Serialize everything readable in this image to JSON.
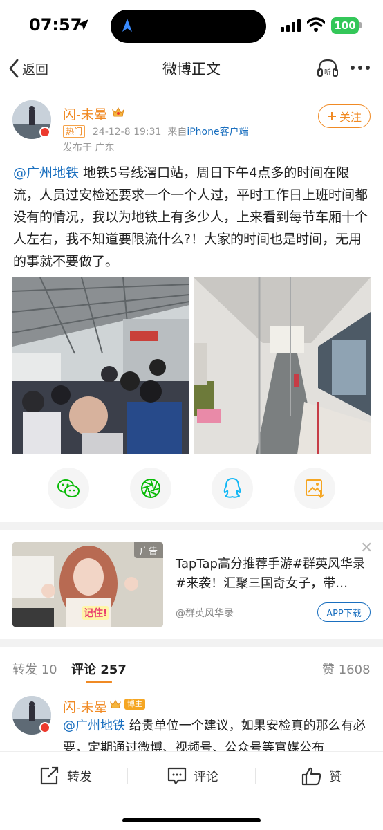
{
  "status_bar": {
    "time": "07:57",
    "battery": "100"
  },
  "nav": {
    "back_label": "返回",
    "title": "微博正文"
  },
  "post": {
    "username": "闪-未晕",
    "hot_tag": "热门",
    "timestamp": "24-12-8 19:31",
    "source_prefix": "来自",
    "source_client": "iPhone客户端",
    "location": "发布于 广东",
    "follow_label": "关注",
    "mention": "@广州地铁",
    "text": " 地铁5号线滘口站，周日下午4点多的时间在限流，人员过安检还要求一个一个人过，平时工作日上班时间都没有的情况，我以为地铁上有多少人，上来看到每节车厢十个人左右，我不知道要限流什么?！大家的时间也是时间，无用的事就不要做了。"
  },
  "share_buttons": [
    "wechat-icon",
    "moments-icon",
    "qq-icon",
    "save-image-icon"
  ],
  "ad": {
    "tag": "广告",
    "overlay_text": "记住!",
    "title": "TapTap高分推荐手游#群英风华录#来袭！汇聚三国奇女子，带…",
    "source": "@群英风华录",
    "button_label": "APP下载",
    "close": "✕"
  },
  "tabs": {
    "repost": "转发 10",
    "comments": "评论 257",
    "likes": "赞 1608"
  },
  "comment": {
    "username": "闪-未晕",
    "badge": "博主",
    "mention": "@广州地铁",
    "text": " 给贵单位一个建议，如果安检真的那么有必要，定期通过微博、视频号、公众号等官媒公布"
  },
  "bottom_actions": {
    "repost": "转发",
    "comment": "评论",
    "like": "赞"
  }
}
